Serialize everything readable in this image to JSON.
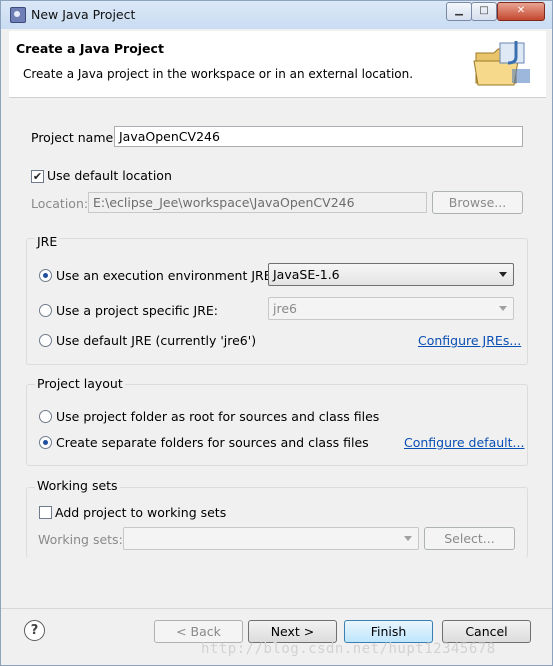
{
  "window": {
    "title": "New Java Project",
    "controls": {
      "minimize": "▁",
      "maximize": "□",
      "close": "✕"
    }
  },
  "banner": {
    "title": "Create a Java Project",
    "description": "Create a Java project in the workspace or in an external location.",
    "icon": "java-project-folder-icon"
  },
  "project": {
    "name_label": "Project name:",
    "name_value": "JavaOpenCV246",
    "use_default_location_label": "Use default location",
    "use_default_location_checked": true,
    "location_label": "Location:",
    "location_value": "E:\\eclipse_Jee\\workspace\\JavaOpenCV246",
    "browse_label": "Browse..."
  },
  "jre": {
    "group_label": "JRE",
    "options": [
      {
        "label": "Use an execution environment JRE:",
        "selected": true,
        "value": "JavaSE-1.6"
      },
      {
        "label": "Use a project specific JRE:",
        "selected": false,
        "value": "jre6"
      },
      {
        "label": "Use default JRE (currently 'jre6')",
        "selected": false
      }
    ],
    "configure_link": "Configure JREs..."
  },
  "layout": {
    "group_label": "Project layout",
    "options": [
      {
        "label": "Use project folder as root for sources and class files",
        "selected": false
      },
      {
        "label": "Create separate folders for sources and class files",
        "selected": true
      }
    ],
    "configure_link": "Configure default..."
  },
  "working_sets": {
    "group_label": "Working sets",
    "add_label": "Add project to working sets",
    "add_checked": false,
    "sets_label": "Working sets:",
    "sets_value": "",
    "select_label": "Select..."
  },
  "footer": {
    "help": "?",
    "back": "< Back",
    "next": "Next >",
    "finish": "Finish",
    "cancel": "Cancel",
    "watermark": "http://blog.csdn.net/hupt12345678"
  }
}
